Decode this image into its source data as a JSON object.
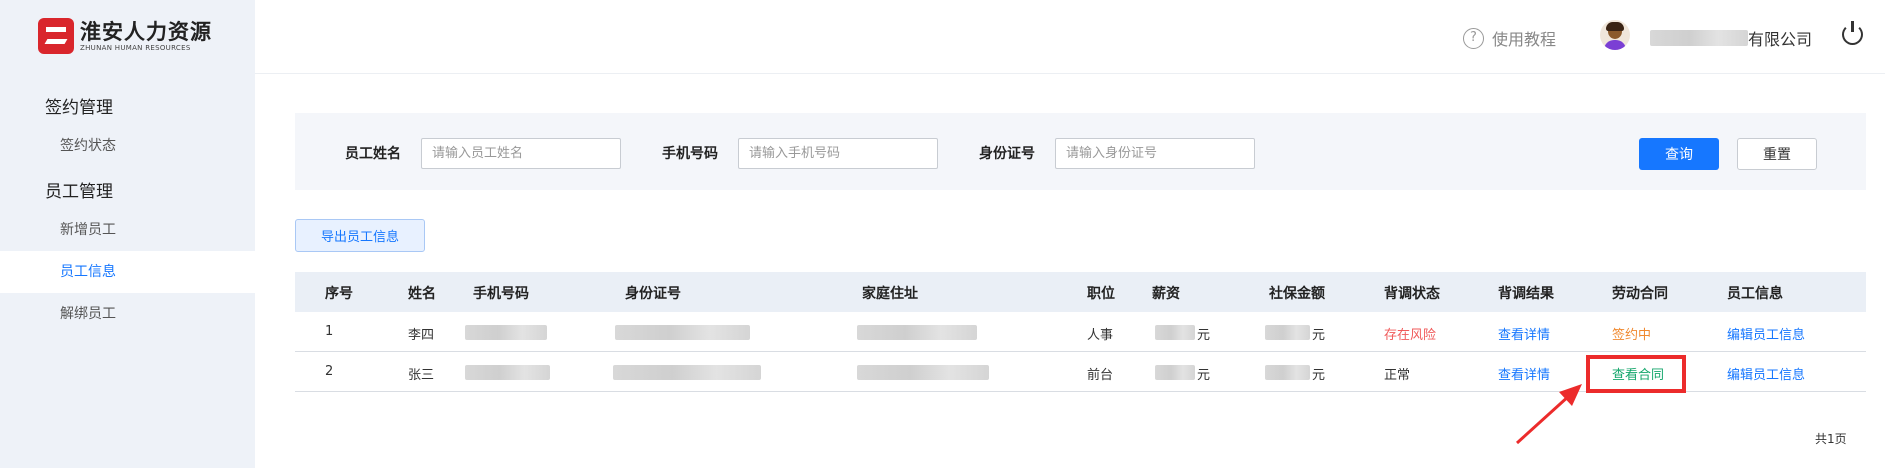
{
  "logo": {
    "cn": "淮安人力资源",
    "en": "ZHUNAN HUMAN RESOURCES"
  },
  "sidebar": {
    "groups": [
      {
        "label": "签约管理",
        "items": [
          {
            "label": "签约状态"
          }
        ]
      },
      {
        "label": "员工管理",
        "items": [
          {
            "label": "新增员工"
          },
          {
            "label": "员工信息",
            "active": true
          },
          {
            "label": "解绑员工"
          }
        ]
      }
    ]
  },
  "header": {
    "help": "使用教程",
    "company_suffix": "有限公司",
    "avatar": "user-avatar",
    "logout_icon": "power-icon"
  },
  "search": {
    "name_label": "员工姓名",
    "name_placeholder": "请输入员工姓名",
    "phone_label": "手机号码",
    "phone_placeholder": "请输入手机号码",
    "id_label": "身份证号",
    "id_placeholder": "请输入身份证号",
    "query": "查询",
    "reset": "重置"
  },
  "toolbar": {
    "export": "导出员工信息"
  },
  "table": {
    "headers": [
      "序号",
      "姓名",
      "手机号码",
      "身份证号",
      "家庭住址",
      "职位",
      "薪资",
      "社保金额",
      "背调状态",
      "背调结果",
      "劳动合同",
      "员工信息"
    ],
    "rows": [
      {
        "index": "1",
        "name": "李四",
        "position": "人事",
        "salary_unit": "元",
        "insurance_unit": "元",
        "bg_status": "存在风险",
        "bg_result": "查看详情",
        "contract": "签约中",
        "info": "编辑员工信息"
      },
      {
        "index": "2",
        "name": "张三",
        "position": "前台",
        "salary_unit": "元",
        "insurance_unit": "元",
        "bg_status": "正常",
        "bg_result": "查看详情",
        "contract": "查看合同",
        "info": "编辑员工信息"
      }
    ]
  },
  "pagination": {
    "total": "共1页"
  },
  "colors": {
    "primary": "#1677ff",
    "risk": "#f05a5a",
    "signing": "#f0892f",
    "contract": "#14a66b",
    "annotation": "#ec2b2b"
  }
}
